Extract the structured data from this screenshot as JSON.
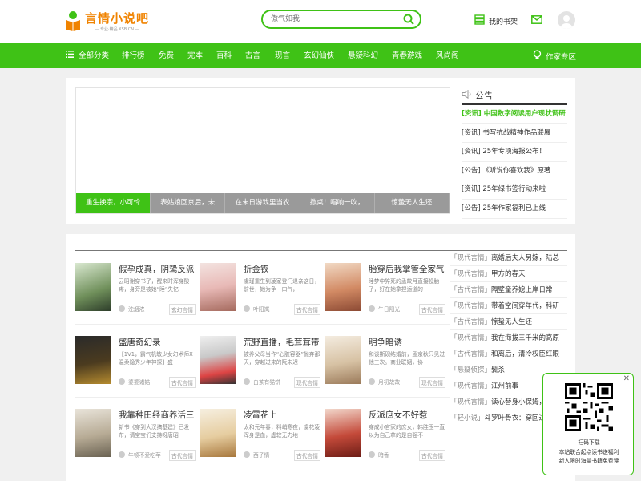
{
  "header": {
    "logo_text": "言情小说吧",
    "logo_sub": "— 专业·精品 XSB.CN —",
    "search_placeholder": "傲气如我",
    "shelf_label": "我的书架"
  },
  "nav": {
    "items": [
      "全部分类",
      "排行榜",
      "免费",
      "完本",
      "百科",
      "古言",
      "现言",
      "玄幻仙侠",
      "悬疑科幻",
      "青春游戏",
      "风尚阁"
    ],
    "author_label": "作家专区"
  },
  "banner": {
    "tabs": [
      "重生换宗，小可怜",
      "表姑娘回京后，未",
      "在末日游戏里当农",
      "掀桌！唱响一吹，",
      "惊蛰无人生还"
    ]
  },
  "notice": {
    "title": "公告",
    "items": [
      "[资讯] 中国数字阅读用户现状调研",
      "[资讯] 书写抗战精神作品联展",
      "[资讯] 25年专项海报公布！",
      "[公告] 《听说你喜欢我》原著",
      "[资讯] 25年绿书签行动来啦",
      "[公告] 25年作家福利已上线"
    ]
  },
  "books": [
    {
      "title": "假孕成真，阴鸷反派",
      "desc": "云昭谢穿书了，醒来时浑身酸疼，身旁是被她“睡”失忆",
      "author": "沈烟浓",
      "tag": "玄幻言情"
    },
    {
      "title": "折金钗",
      "desc": "虞瑾重生到凌家登门退亲这日，前世，她为争一口气，",
      "author": "叶阳岚",
      "tag": "古代言情"
    },
    {
      "title": "胎穿后我掌管全家气",
      "desc": "睡梦中猝死的孟皎月直接投胎了，好在她拿捏运道的一",
      "author": "午日阳光",
      "tag": "古代言情"
    },
    {
      "title": "盛唐奇幻录",
      "desc": "【1V1，霸气机敏少女幻术师X温柔隐秀少年神探】盛",
      "author": "婆婆诸姑",
      "tag": "古代言情"
    },
    {
      "title": "荒野直播，毛茸茸带",
      "desc": "被养父母当作“心脏容器”抛弃那天，穿越过来的阮未迟",
      "author": "白茶有猫饼",
      "tag": "现代言情"
    },
    {
      "title": "明争暗诱",
      "desc": "和谈斯砚结婚前，孟京秋只见过他三次。商业联姻，协",
      "author": "月初故故",
      "tag": "现代言情"
    },
    {
      "title": "我靠种田经商养活三",
      "desc": "新书《穿到大汉搞基建》已发布，请宝宝们支持呀唐昭",
      "author": "牛顿不爱吃苹",
      "tag": "古代言情"
    },
    {
      "title": "凌霄花上",
      "desc": "太和元年春，料峭寒夜，虞花凌浑身是血，虚软无力地",
      "author": "西子情",
      "tag": "古代言情"
    },
    {
      "title": "反派庶女不好惹",
      "desc": "穿成小官家的庶女，韩胜玉一直以为自己拿的是自强不",
      "author": "暗香",
      "tag": "古代言情"
    }
  ],
  "ranking": [
    {
      "cat": "「现代言情」",
      "title": "离婚后夫人另嫁，陆总"
    },
    {
      "cat": "「现代言情」",
      "title": "甲方的春天"
    },
    {
      "cat": "「古代言情」",
      "title": "隔壁童养媳上岸日常"
    },
    {
      "cat": "「现代言情」",
      "title": "带着空间穿年代，科研"
    },
    {
      "cat": "「古代言情」",
      "title": "惊蛰无人生还"
    },
    {
      "cat": "「现代言情」",
      "title": "我在海拔三千米的高原"
    },
    {
      "cat": "「古代言情」",
      "title": "和离后，清冷权臣红眼"
    },
    {
      "cat": "「悬疑侦探」",
      "title": "鬓杀"
    },
    {
      "cat": "「现代言情」",
      "title": "江州前事"
    },
    {
      "cat": "「现代言情」",
      "title": "读心替身小保姆，"
    },
    {
      "cat": "「轻小说」",
      "title": "斗罗叶骨衣：穿回过"
    }
  ],
  "qr": {
    "title": "扫码下载",
    "line1": "本站联合起点读书送福利",
    "line2": "新人限时海量书籍免费读"
  },
  "colors": {
    "brand": "#3fc216",
    "logo": "#f08300"
  },
  "icons": [
    "book-logo-icon",
    "search-icon",
    "bookshelf-icon",
    "mail-icon",
    "menu-icon",
    "lightbulb-icon",
    "speaker-icon",
    "close-icon"
  ]
}
